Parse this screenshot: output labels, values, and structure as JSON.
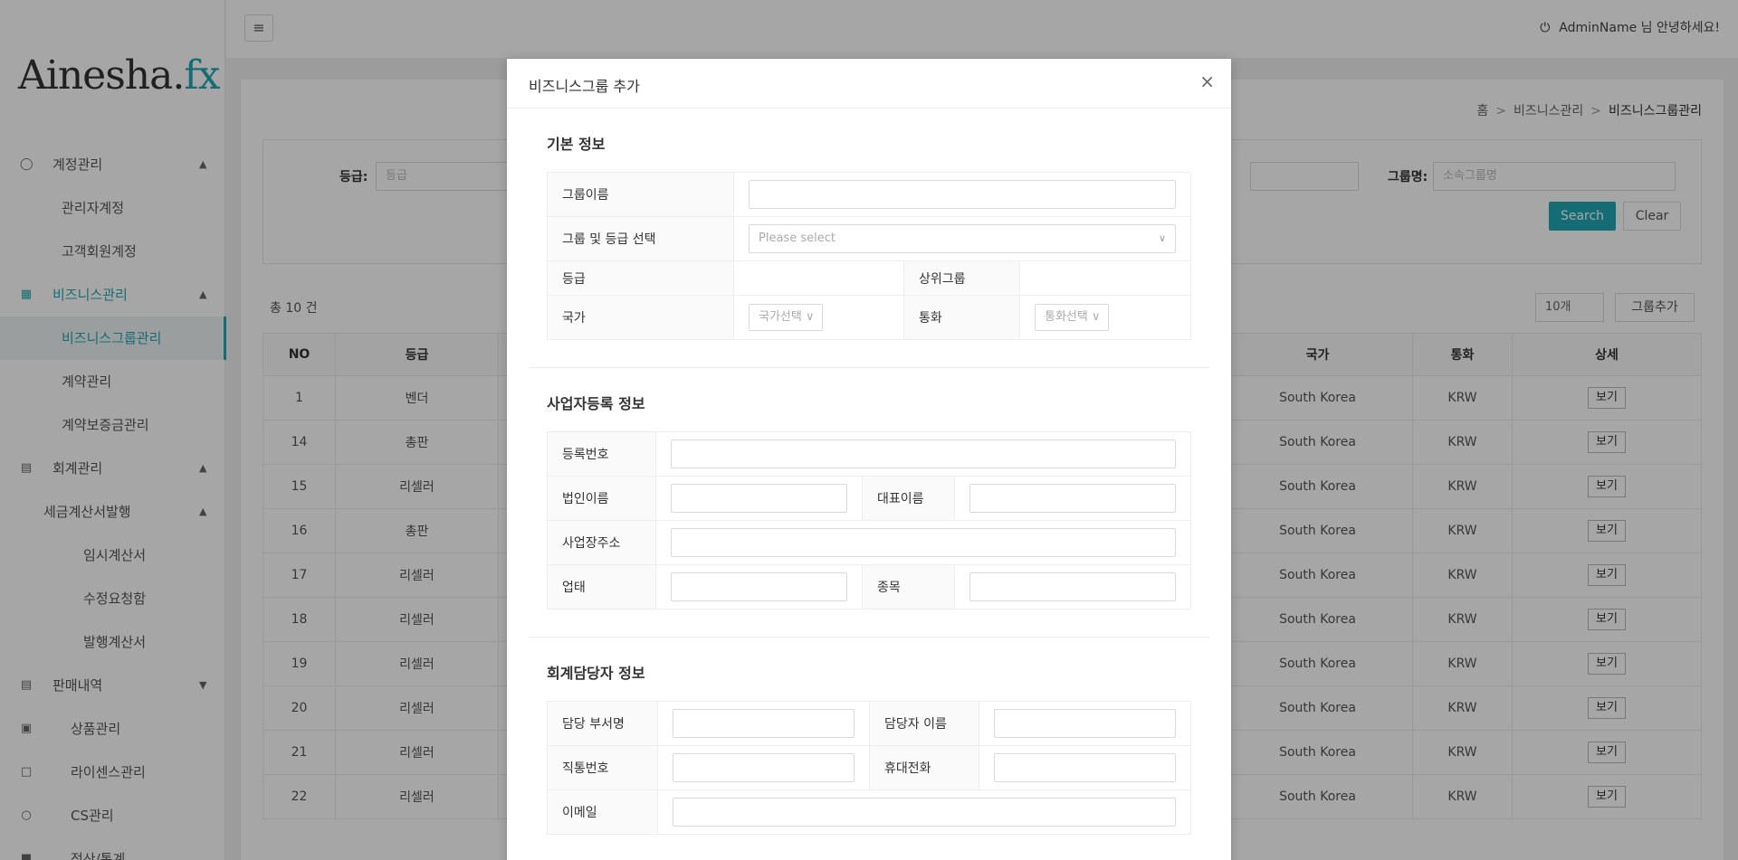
{
  "brand": {
    "logo_main": "Ainesha.",
    "logo_accent": "fx"
  },
  "header": {
    "user_greeting": "AdminName 님 안녕하세요!"
  },
  "sidebar": {
    "items": [
      {
        "label": "계정관리"
      },
      {
        "label": "관리자계정"
      },
      {
        "label": "고객회원계정"
      },
      {
        "label": "비즈니스관리"
      },
      {
        "label": "비즈니스그룹관리"
      },
      {
        "label": "계약관리"
      },
      {
        "label": "계약보증금관리"
      },
      {
        "label": "회계관리"
      },
      {
        "label": "세금계산서발행"
      },
      {
        "label": "임시계산서"
      },
      {
        "label": "수정요청함"
      },
      {
        "label": "발행계산서"
      },
      {
        "label": "판매내역"
      },
      {
        "label": "상품관리"
      },
      {
        "label": "라이센스관리"
      },
      {
        "label": "CS관리"
      },
      {
        "label": "정산/통계"
      }
    ]
  },
  "breadcrumb": {
    "home": "홈",
    "level1": "비즈니스관리",
    "current": "비즈니스그룹관리",
    "separator": ">"
  },
  "filters": {
    "grade_label": "등급:",
    "grade_placeholder": "등급",
    "group_name_label": "그룹명:",
    "group_name_placeholder": "소속그룹명",
    "search_button": "Search",
    "clear_button": "Clear"
  },
  "list": {
    "total_text": "총 10 건",
    "page_size": "10개",
    "add_button": "그룹추가",
    "columns": {
      "no": "NO",
      "grade": "등급",
      "country": "국가",
      "currency": "통화",
      "detail": "상세"
    },
    "rows": [
      {
        "no": "1",
        "grade": "벤더",
        "country": "South Korea",
        "currency": "KRW",
        "detail": "보기"
      },
      {
        "no": "14",
        "grade": "총판",
        "country": "South Korea",
        "currency": "KRW",
        "detail": "보기"
      },
      {
        "no": "15",
        "grade": "리셀러",
        "country": "South Korea",
        "currency": "KRW",
        "detail": "보기"
      },
      {
        "no": "16",
        "grade": "총판",
        "country": "South Korea",
        "currency": "KRW",
        "detail": "보기"
      },
      {
        "no": "17",
        "grade": "리셀러",
        "country": "South Korea",
        "currency": "KRW",
        "detail": "보기"
      },
      {
        "no": "18",
        "grade": "리셀러",
        "country": "South Korea",
        "currency": "KRW",
        "detail": "보기"
      },
      {
        "no": "19",
        "grade": "리셀러",
        "country": "South Korea",
        "currency": "KRW",
        "detail": "보기"
      },
      {
        "no": "20",
        "grade": "리셀러",
        "country": "South Korea",
        "currency": "KRW",
        "detail": "보기"
      },
      {
        "no": "21",
        "grade": "리셀러",
        "country": "South Korea",
        "currency": "KRW",
        "detail": "보기"
      },
      {
        "no": "22",
        "grade": "리셀러",
        "country": "South Korea",
        "currency": "KRW",
        "detail": "보기"
      }
    ]
  },
  "modal": {
    "title": "비즈니스그룹 추가",
    "close": "×",
    "basic": {
      "title": "기본 정보",
      "group_name": "그룹이름",
      "group_grade_select": "그룹 및 등급 선택",
      "select_placeholder": "Please select",
      "grade": "등급",
      "parent_group": "상위그룹",
      "country": "국가",
      "country_placeholder": "국가선택",
      "currency": "통화",
      "currency_placeholder": "통화선택"
    },
    "business": {
      "title": "사업자등록 정보",
      "reg_no": "등록번호",
      "corp_name": "법인이름",
      "ceo_name": "대표이름",
      "address": "사업장주소",
      "biz_type": "업태",
      "biz_item": "종목"
    },
    "accounting": {
      "title": "회계담당자 정보",
      "dept": "담당 부서명",
      "manager": "담당자 이름",
      "direct_phone": "직통번호",
      "mobile": "휴대전화",
      "email": "이메일"
    }
  },
  "colors": {
    "accent": "#1fa8b3"
  }
}
